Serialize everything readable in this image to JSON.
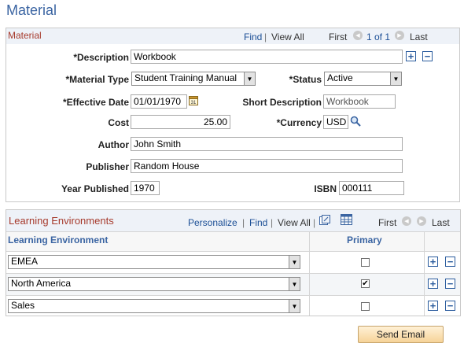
{
  "page": {
    "title": "Material"
  },
  "material": {
    "group_title": "Material",
    "nav": {
      "find": "Find",
      "sep": "|",
      "view_all": "View All",
      "first": "First",
      "range": "1 of 1",
      "last": "Last"
    },
    "labels": {
      "description": "*Description",
      "material_type": "*Material Type",
      "status": "*Status",
      "effective_date": "*Effective Date",
      "short_description": "Short Description",
      "cost": "Cost",
      "currency": "*Currency",
      "author": "Author",
      "publisher": "Publisher",
      "year_published": "Year Published",
      "isbn": "ISBN"
    },
    "values": {
      "description": "Workbook",
      "material_type": "Student Training Manual",
      "status": "Active",
      "effective_date": "01/01/1970",
      "short_description": "Workbook",
      "cost": "25.00",
      "currency": "USD",
      "author": "John Smith",
      "publisher": "Random House",
      "year_published": "1970",
      "isbn": "000111"
    },
    "buttons": {
      "add": "+",
      "remove": "−"
    }
  },
  "learning_environments": {
    "title": "Learning Environments",
    "nav": {
      "personalize": "Personalize",
      "find": "Find",
      "view_all": "View All",
      "sep": "|",
      "first": "First",
      "last": "Last"
    },
    "columns": {
      "environment": "Learning Environment",
      "primary": "Primary"
    },
    "rows": [
      {
        "environment": "EMEA",
        "primary": false
      },
      {
        "environment": "North America",
        "primary": true
      },
      {
        "environment": "Sales",
        "primary": false
      }
    ],
    "buttons": {
      "add": "+",
      "remove": "−"
    }
  },
  "actions": {
    "send_email": "Send Email"
  },
  "icons": {
    "calendar": "calendar-icon",
    "lookup": "magnifier-icon",
    "prev": "chevron-left-icon",
    "next": "chevron-right-icon",
    "zoom": "zoom-grid-icon",
    "download": "download-grid-icon"
  },
  "colors": {
    "title": "#3a64a2",
    "group_title": "#a63a2c",
    "link": "#1c4f96",
    "button_bg": "#f6d398"
  }
}
